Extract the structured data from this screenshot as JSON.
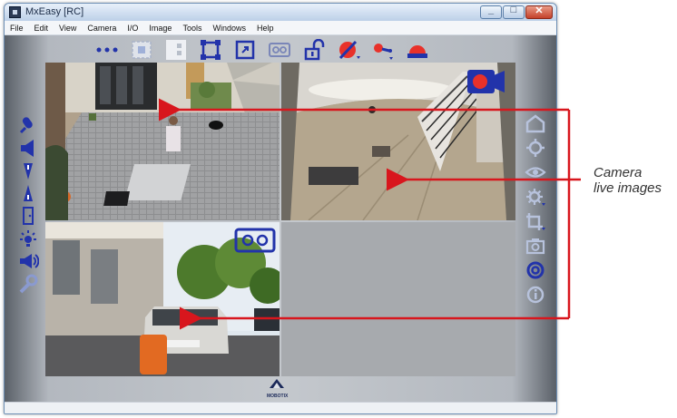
{
  "window": {
    "title": "MxEasy [RC]"
  },
  "menu": [
    "File",
    "Edit",
    "View",
    "Camera",
    "I/O",
    "Image",
    "Tools",
    "Windows",
    "Help"
  ],
  "logo_text": "MOBOTIX",
  "annotation": {
    "line1": "Camera",
    "line2": "live images"
  },
  "colors": {
    "accent_blue": "#2233aa",
    "alert_red": "#e8312a",
    "arrow_red": "#d8161d"
  }
}
